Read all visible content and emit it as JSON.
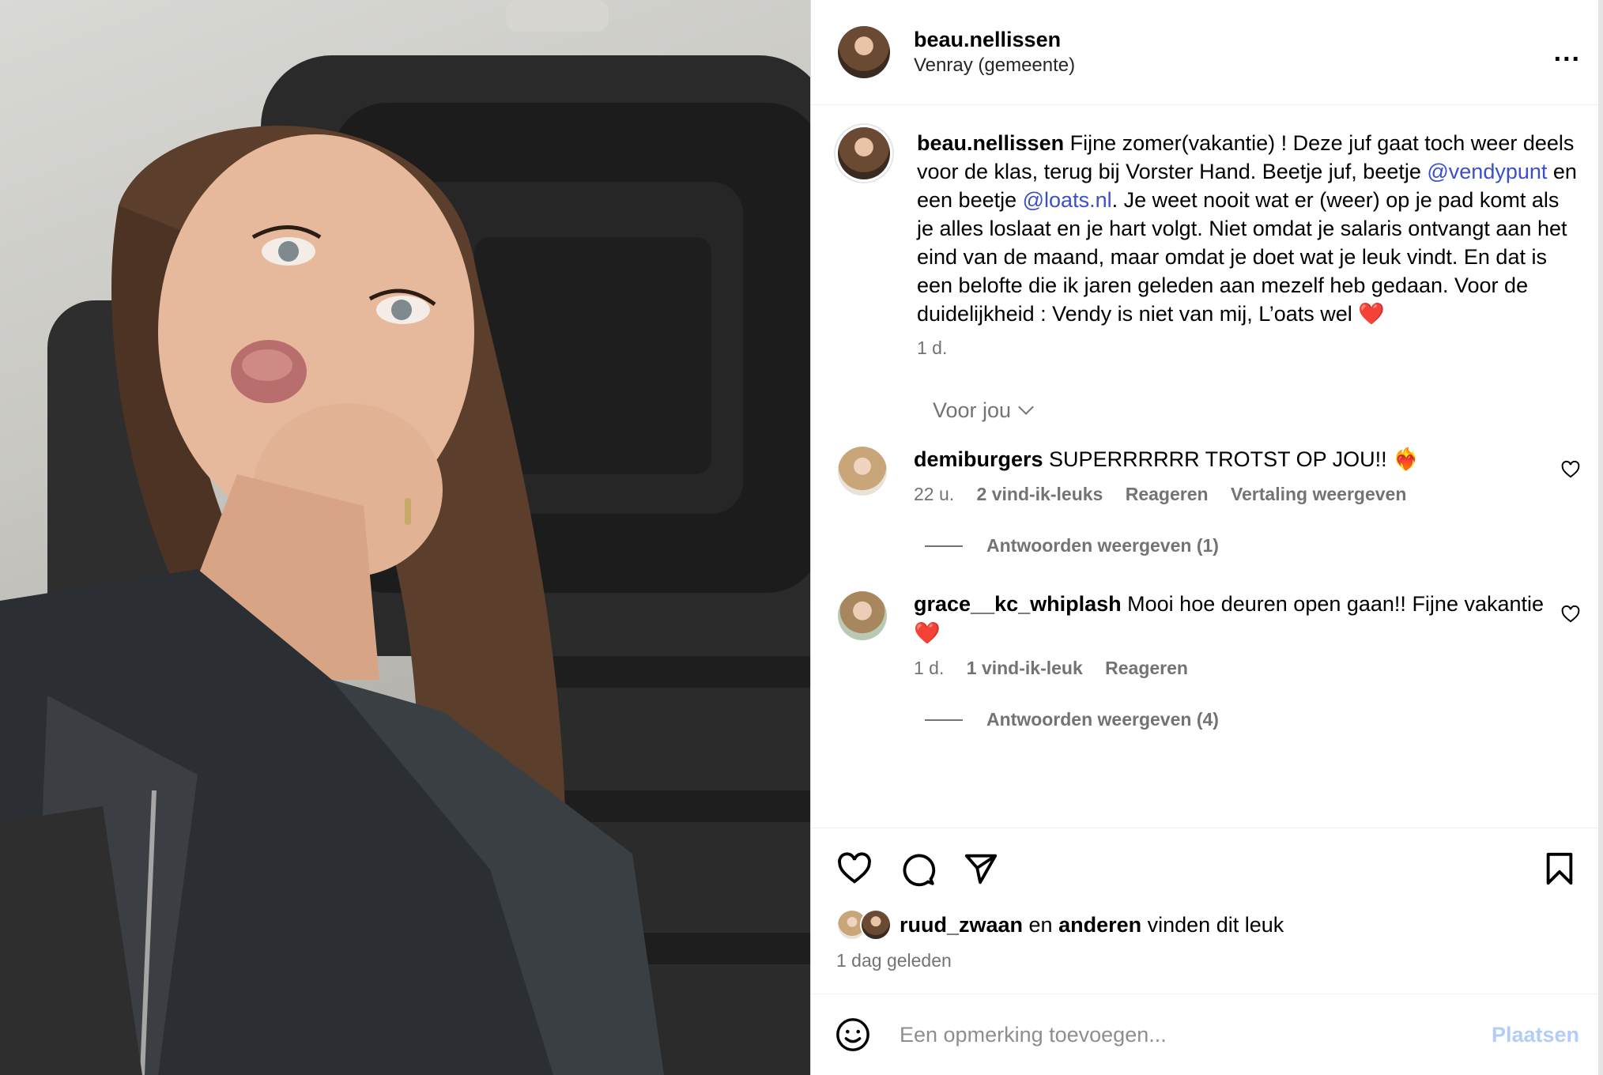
{
  "post": {
    "username": "beau.nellissen",
    "location": "Venray (gemeente)",
    "more_label": "...",
    "caption": {
      "username": "beau.nellissen",
      "text_1": " Fijne zomer(vakantie) ! Deze juf gaat toch weer deels voor de klas, terug bij Vorster Hand. Beetje juf, beetje ",
      "mention_1": "@vendypunt",
      "text_2": " en een beetje ",
      "mention_2": "@loats.nl",
      "text_3": ". Je weet nooit wat er (weer) op je pad komt als je alles loslaat en je hart volgt. Niet omdat je salaris ontvangt aan het eind van de maand, maar omdat je doet wat je leuk vindt. En dat is een belofte die ik jaren geleden aan mezelf heb gedaan. Voor de duidelijkheid : Vendy is niet van mij, L’oats wel ",
      "emoji": "❤️",
      "time": "1 d."
    },
    "for_you_label": "Voor jou",
    "comments": [
      {
        "username": "demiburgers",
        "text": " SUPERRRRRR TROTST OP JOU!! ❤️‍🔥",
        "time": "22 u.",
        "likes": "2 vind-ik-leuks",
        "reply": "Reageren",
        "translate": "Vertaling weergeven",
        "view_replies": "Antwoorden weergeven (1)"
      },
      {
        "username": "grace__kc_whiplash",
        "text": " Mooi hoe deuren open gaan!! Fijne vakantie ❤️",
        "time": "1 d.",
        "likes": "1 vind-ik-leuk",
        "reply": "Reageren",
        "view_replies": "Antwoorden weergeven (4)"
      }
    ],
    "liked_by": {
      "user": "ruud_zwaan",
      "and": " en ",
      "others": "anderen",
      "suffix": " vinden dit leuk"
    },
    "posted_ago": "1 dag geleden",
    "compose": {
      "placeholder": "Een opmerking toevoegen...",
      "post_label": "Plaatsen"
    },
    "colors": {
      "mention": "#3b4fc8",
      "post_button_disabled": "#b3cdf7",
      "secondary_text": "#737373"
    },
    "icons": [
      "heart-icon",
      "comment-icon",
      "share-icon",
      "bookmark-icon",
      "emoji-icon"
    ]
  }
}
